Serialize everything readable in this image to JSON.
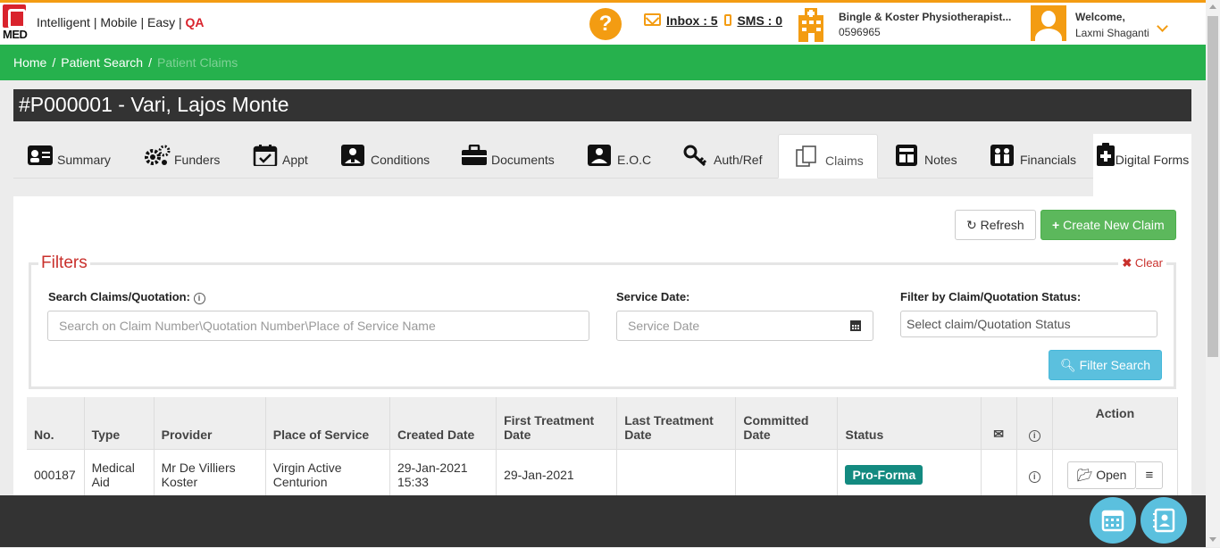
{
  "header": {
    "logo_text": "MED",
    "tagline": "Intelligent | Mobile | Easy | ",
    "tagline_env": "QA",
    "help_label": "?",
    "inbox_label": "Inbox : 5",
    "sms_label": "SMS : 0",
    "practice_name": "Bingle & Koster Physiotherapist...",
    "practice_number": "0596965",
    "welcome_label": "Welcome,",
    "user_name": "Laxmi Shaganti",
    "accent_color": "#f39c12"
  },
  "breadcrumb": {
    "home": "Home",
    "patient_search": "Patient Search",
    "current": "Patient Claims",
    "separator": "/"
  },
  "patient": {
    "title": "#P000001 - Vari, Lajos Monte"
  },
  "tabs": {
    "summary": "Summary",
    "funders": "Funders",
    "appt": "Appt",
    "conditions": "Conditions",
    "documents": "Documents",
    "eoc": "E.O.C",
    "authref": "Auth/Ref",
    "claims": "Claims",
    "notes": "Notes",
    "financials": "Financials",
    "digital_forms": "Digital Forms"
  },
  "actions": {
    "refresh": "Refresh",
    "create": "Create New Claim"
  },
  "filters": {
    "legend": "Filters",
    "clear": "Clear",
    "search_label": "Search Claims/Quotation:",
    "search_placeholder": "Search on Claim Number\\Quotation Number\\Place of Service Name",
    "date_label": "Service Date:",
    "date_placeholder": "Service Date",
    "status_label": "Filter by Claim/Quotation Status:",
    "status_placeholder": "Select claim/Quotation Status",
    "filter_button": "Filter Search"
  },
  "table": {
    "headers": {
      "no": "No.",
      "type": "Type",
      "provider": "Provider",
      "place": "Place of Service",
      "created": "Created Date",
      "first": "First Treatment Date",
      "last": "Last Treatment Date",
      "committed": "Committed Date",
      "status": "Status",
      "action": "Action"
    },
    "rows": [
      {
        "no": "000187",
        "type": "Medical Aid",
        "provider": "Mr De Villiers Koster",
        "place": "Virgin Active Centurion",
        "created": "29-Jan-2021 15:33",
        "first": "29-Jan-2021",
        "last": "",
        "committed": "",
        "status": "Pro-Forma",
        "open": "Open"
      }
    ]
  }
}
